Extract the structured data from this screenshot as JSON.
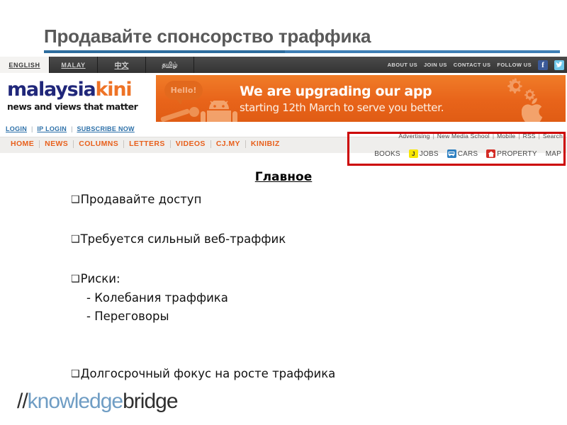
{
  "slide": {
    "title": "Продавайте спонсорство траффика",
    "heading": "Главное",
    "bullets": [
      {
        "mark": "❑",
        "text": "Продавайте доступ"
      },
      {
        "mark": "❑",
        "text": "Требуется сильный веб-траффик"
      },
      {
        "mark": "❑",
        "text": "Риски:"
      }
    ],
    "sub_lines": [
      "- Колебания траффика",
      "- Переговоры"
    ],
    "final_bullet": {
      "mark": "❑",
      "text": "Долгосрочный фокус на росте траффика"
    }
  },
  "footer": {
    "logo_slashes": "//",
    "logo_part_a": "knowledge",
    "logo_part_b": "bridge"
  },
  "site": {
    "language_tabs": [
      {
        "label": "ENGLISH",
        "active": true
      },
      {
        "label": "MALAY",
        "active": false
      },
      {
        "label": "中文",
        "active": false
      },
      {
        "label": "தமிழ்",
        "active": false
      }
    ],
    "utility_links": [
      "ABOUT US",
      "JOIN US",
      "CONTACT US",
      "FOLLOW US"
    ],
    "social": [
      {
        "name": "facebook-icon",
        "glyph": "f"
      },
      {
        "name": "twitter-icon",
        "glyph": "t"
      }
    ],
    "brand": {
      "part_a": "malaysia",
      "part_b": "kini",
      "tagline": "news and views that matter"
    },
    "banner": {
      "line1": "We are upgrading our app",
      "line2": "starting 12th March to serve you better.",
      "bubble": "Hello!"
    },
    "subnav": [
      {
        "label": "LOGIN"
      },
      {
        "label": "IP LOGIN"
      },
      {
        "label": "SUBSCRIBE NOW"
      }
    ],
    "subnav_separator": "|",
    "mainnav": [
      "HOME",
      "NEWS",
      "COLUMNS",
      "LETTERS",
      "VIDEOS",
      "CJ.MY",
      "KINIBIZ"
    ],
    "services_top": [
      "Advertising",
      "New Media School",
      "Mobile",
      "RSS",
      "Search"
    ],
    "services_separator": "|",
    "services_bottom": [
      {
        "label": "BOOKS",
        "icon": null,
        "glyph": ""
      },
      {
        "label": "JOBS",
        "icon": "jobs",
        "glyph": "J"
      },
      {
        "label": "CARS",
        "icon": "cars",
        "glyph": "▭"
      },
      {
        "label": "PROPERTY",
        "icon": "property",
        "glyph": "⌂"
      },
      {
        "label": "MAP",
        "icon": null,
        "glyph": ""
      }
    ]
  },
  "colors": {
    "title_text": "#595959",
    "title_rule": "#3f7fb5",
    "brand_navy": "#20277a",
    "brand_orange": "#ee7326",
    "banner_orange": "#e8641a",
    "nav_orange": "#e8601c",
    "highlight_red": "#cc0000",
    "logo_blue": "#6f9dc4"
  }
}
